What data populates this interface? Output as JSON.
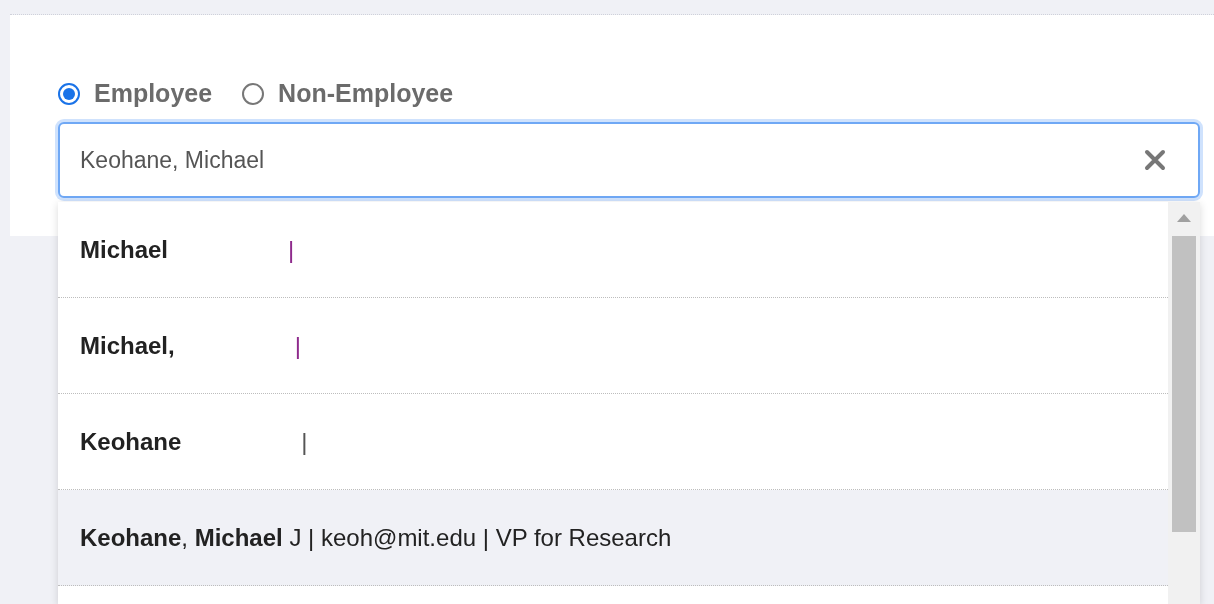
{
  "person_type": [
    {
      "label": "Employee",
      "selected": true
    },
    {
      "label": "Non-Employee",
      "selected": false
    }
  ],
  "search": {
    "value": "Keohane, Michael"
  },
  "results": [
    {
      "kind": "redacted",
      "text": "Michael",
      "separator": "|",
      "color": "#8e2a8c",
      "selected": false
    },
    {
      "kind": "redacted",
      "text": "Michael,",
      "separator": "|",
      "color": "#8e2a8c",
      "selected": false
    },
    {
      "kind": "redacted",
      "text": "Keohane",
      "separator": "|",
      "color": "#555555",
      "selected": false
    },
    {
      "kind": "full",
      "text": "**Keohane**, **Michael** J | keoh@mit.edu | VP for Research",
      "selected": true
    }
  ]
}
